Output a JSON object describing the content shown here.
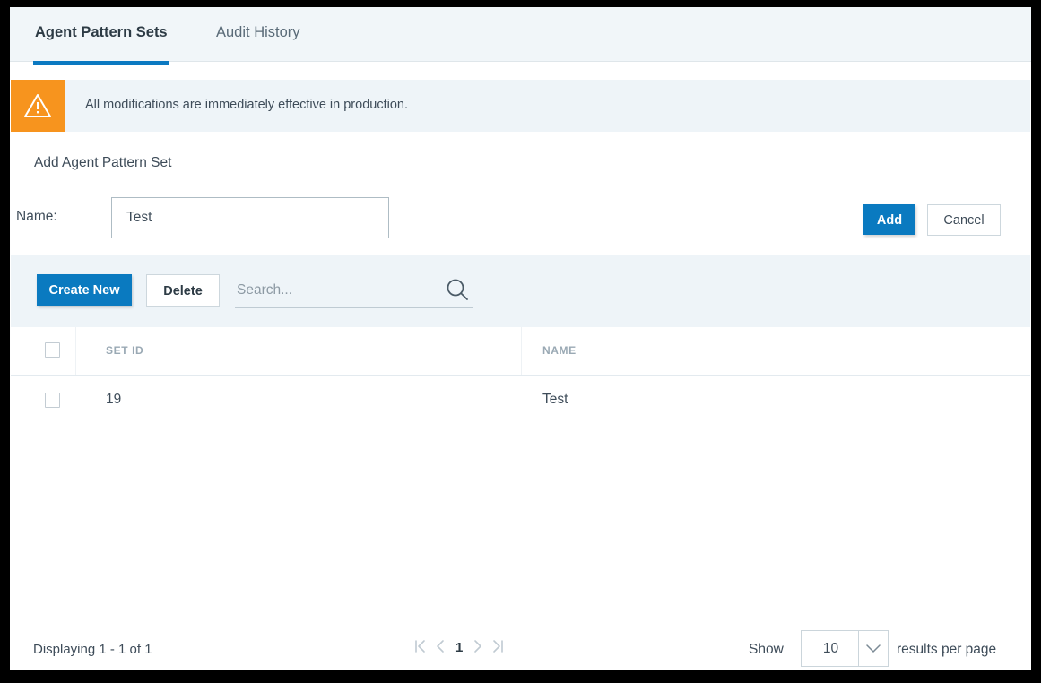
{
  "tabs": [
    {
      "label": "Agent Pattern Sets",
      "active": true
    },
    {
      "label": "Audit History",
      "active": false
    }
  ],
  "banner": {
    "icon": "warning-triangle-icon",
    "message": "All modifications are immediately effective in production.",
    "icon_bg": "#f7941e",
    "bg": "#eef4f8"
  },
  "form": {
    "title": "Add Agent Pattern Set",
    "name_label": "Name:",
    "name_value": "Test",
    "name_placeholder": "",
    "add_label": "Add",
    "cancel_label": "Cancel",
    "primary_color": "#0a7ac0"
  },
  "toolbar": {
    "create_label": "Create New",
    "delete_label": "Delete",
    "search_placeholder": "Search...",
    "search_value": "",
    "search_icon": "magnifier-icon"
  },
  "table": {
    "columns": [
      "SET ID",
      "NAME"
    ],
    "rows": [
      {
        "set_id": "19",
        "name": "Test"
      }
    ]
  },
  "footer": {
    "displaying": "Displaying 1 - 1 of 1",
    "pager": {
      "first": "⟨⟨",
      "prev": "⟨",
      "current_page": "1",
      "next": "⟩",
      "last": "⟩⟩"
    },
    "show_label": "Show",
    "page_size": "10",
    "results_label": "results per page"
  }
}
